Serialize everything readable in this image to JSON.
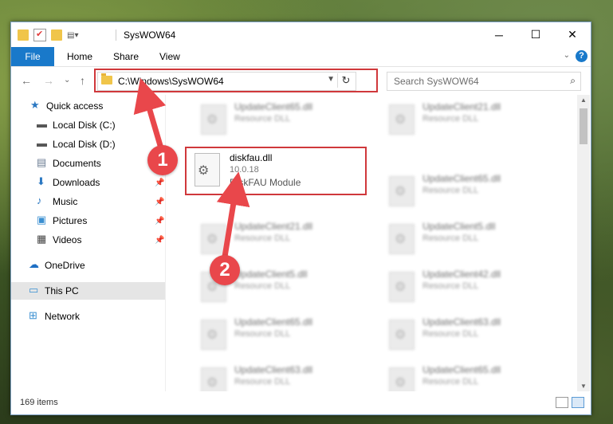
{
  "window": {
    "title": "SysWOW64",
    "controls": {
      "minimize": "─",
      "maximize": "☐",
      "close": "✕"
    }
  },
  "ribbon": {
    "tabs": [
      "File",
      "Home",
      "Share",
      "View"
    ],
    "help": "?",
    "collapse": "⌄"
  },
  "navbar": {
    "back": "←",
    "forward": "→",
    "recent": "⌄",
    "up": "↑",
    "address": "C:\\Windows\\SysWOW64",
    "refresh": "↻",
    "search_placeholder": "Search SysWOW64",
    "search_icon": "⌕"
  },
  "nav_pane": {
    "items": [
      {
        "label": "Quick access",
        "icon": "star-icon",
        "color": "#2b78c2"
      },
      {
        "label": "Local Disk (C:)",
        "icon": "drive-icon",
        "color": "#555555"
      },
      {
        "label": "Local Disk (D:)",
        "icon": "drive-icon",
        "color": "#555555"
      },
      {
        "label": "Documents",
        "icon": "documents-icon",
        "color": "#6b7c93"
      },
      {
        "label": "Downloads",
        "icon": "download-icon",
        "color": "#2b78c2",
        "pin": "📌"
      },
      {
        "label": "Music",
        "icon": "music-icon",
        "color": "#2b78c2",
        "pin": "📌"
      },
      {
        "label": "Pictures",
        "icon": "pictures-icon",
        "color": "#3a8fd1",
        "pin": "📌"
      },
      {
        "label": "Videos",
        "icon": "videos-icon",
        "color": "#444444",
        "pin": "📌"
      },
      {
        "label": "OneDrive",
        "icon": "cloud-icon",
        "color": "#1e6fc4"
      },
      {
        "label": "This PC",
        "icon": "computer-icon",
        "color": "#3a8fd1",
        "selected": true
      },
      {
        "label": "Network",
        "icon": "network-icon",
        "color": "#3a8fd1"
      }
    ]
  },
  "files": {
    "left": [
      {
        "name": "UpdateClient65.dll",
        "type": "Resource DLL"
      },
      {
        "name": "UpdateClient21.dll",
        "type": "Resource DLL"
      },
      {
        "name": "UpdateClient5.dll",
        "type": "Resource DLL"
      },
      {
        "name": "UpdateClient65.dll",
        "type": "Resource DLL"
      },
      {
        "name": "UpdateClient63.dll",
        "type": "Resource DLL"
      }
    ],
    "right": [
      {
        "name": "UpdateClient21.dll",
        "type": "Resource DLL"
      },
      {
        "name": "UpdateClient65.dll",
        "type": "Resource DLL"
      },
      {
        "name": "UpdateClient5.dll",
        "type": "Resource DLL"
      },
      {
        "name": "UpdateClient42.dll",
        "type": "Resource DLL"
      },
      {
        "name": "UpdateClient63.dll",
        "type": "Resource DLL"
      },
      {
        "name": "UpdateClient65.dll",
        "type": "Resource DLL"
      }
    ],
    "selected": {
      "name": "diskfau.dll",
      "version": "10.0.18",
      "description": "DiskFAU Module"
    }
  },
  "status": {
    "item_count": "169 items"
  },
  "annotations": {
    "step1": "1",
    "step2": "2",
    "highlight_color": "#d0383b"
  }
}
